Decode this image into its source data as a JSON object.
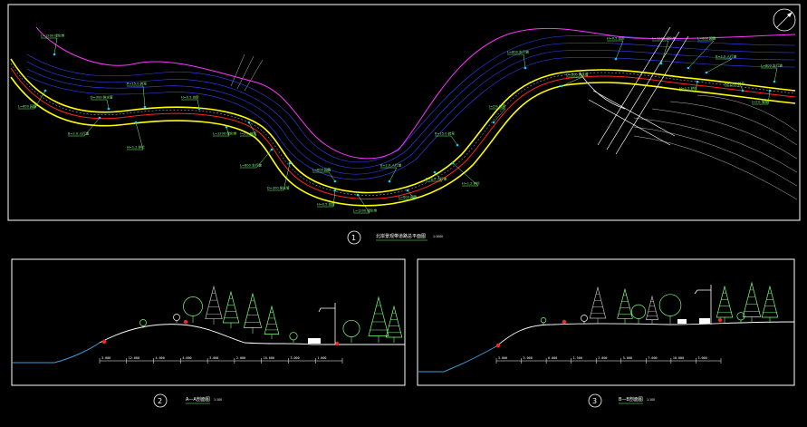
{
  "drawing": {
    "colors": {
      "background": "#000000",
      "frame": "#ffffff",
      "road_edge": "#ffff00",
      "river_bank": "#ff33ff",
      "contours": "#3344ff",
      "annotation": "#7dff7d",
      "dimension": "#ffffff",
      "water": "#3a9bd8",
      "red_markers": "#ff2222",
      "grey_lines": "#bbbbbb"
    },
    "plan_view": {
      "marker_number": "1",
      "title": "北岸景观带道路总平面图",
      "scale": "1:1000"
    },
    "sections": [
      {
        "marker_number": "2",
        "title": "A—A剖面图",
        "scale": "1:100",
        "dimensions": [
          "3.000",
          "12.000",
          "4.000",
          "4.000",
          "3.000",
          "2.000",
          "10.000",
          "3.000",
          "1.000"
        ]
      },
      {
        "marker_number": "3",
        "title": "B—B剖面图",
        "scale": "1:100",
        "dimensions": [
          "3.000",
          "3.000",
          "6.000",
          "1.500",
          "2.000",
          "5.000",
          "7.000",
          "10.000",
          "3.000"
        ]
      }
    ],
    "plan_notes": [
      "L=1200 绿化带",
      "L=600 园路",
      "B=2.0 人行道",
      "H=1.2 护栏",
      "R=15.0 转弯",
      "i=2% 坡度",
      "L=800 车行道",
      "D=300 排水管",
      "H=0.5 台阶"
    ],
    "north_arrow": "north-arrow-icon"
  }
}
